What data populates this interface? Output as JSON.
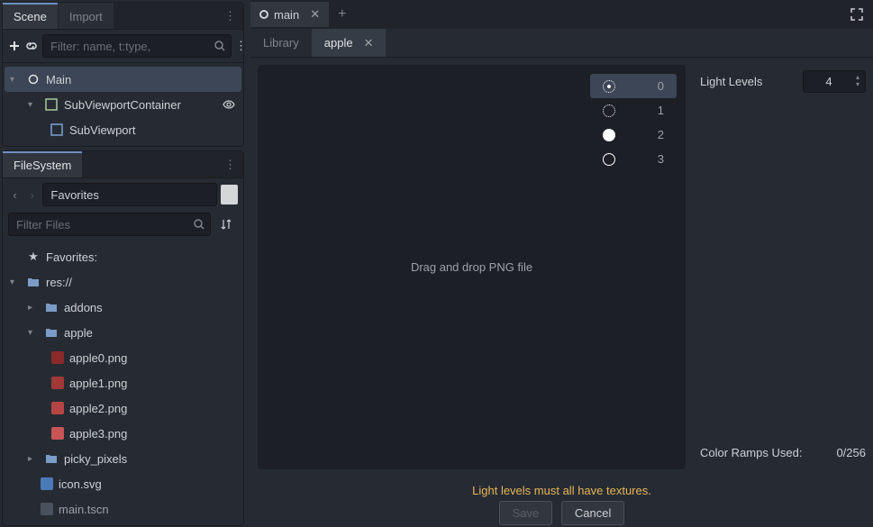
{
  "scene_panel": {
    "tabs": {
      "scene": "Scene",
      "import": "Import"
    },
    "filter_placeholder": "Filter: name, t:type,",
    "tree": {
      "main": "Main",
      "svc": "SubViewportContainer",
      "sv": "SubViewport"
    }
  },
  "filesystem_panel": {
    "title": "FileSystem",
    "path": "Favorites",
    "filter_placeholder": "Filter Files",
    "favorites_label": "Favorites:",
    "root": "res://",
    "folders": {
      "addons": "addons",
      "apple": "apple",
      "picky": "picky_pixels"
    },
    "files": {
      "a0": "apple0.png",
      "a1": "apple1.png",
      "a2": "apple2.png",
      "a3": "apple3.png",
      "icon": "icon.svg",
      "main": "main.tscn"
    }
  },
  "editor": {
    "main_tab": "main",
    "sub_tabs": {
      "library": "Library",
      "apple": "apple"
    },
    "dropzone": "Drag and drop PNG file",
    "light_levels": [
      "0",
      "1",
      "2",
      "3"
    ],
    "prop_label": "Light Levels",
    "prop_value": "4",
    "ramps_label": "Color Ramps Used:",
    "ramps_value": "0/256",
    "warning": "Light levels must all have textures.",
    "save": "Save",
    "cancel": "Cancel"
  }
}
